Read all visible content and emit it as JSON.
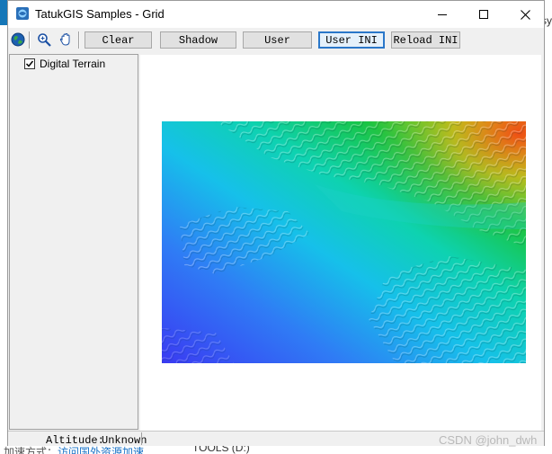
{
  "window": {
    "title": "TatukGIS Samples - Grid"
  },
  "toolbar": {
    "icons": [
      "globe-icon",
      "zoom-icon",
      "pan-hand-icon"
    ],
    "buttons": [
      "Clear",
      "Shadow",
      "User",
      "User INI",
      "Reload INI"
    ]
  },
  "layers": [
    {
      "label": "Digital Terrain",
      "checked": true
    }
  ],
  "status": {
    "label": "Altitude:",
    "value": "Unknown"
  },
  "background": {
    "bottom_text_1": "加速方式：",
    "bottom_text_2": "访问国外资源加速",
    "bottom_text_3": "TOOLS (D:)",
    "watermark": "CSDN @john_dwh",
    "right_text": "sy"
  },
  "colors": {
    "focus_border": "#2a77c9",
    "window_bg": "#f0f0f0",
    "map_bg": "#ffffff"
  }
}
